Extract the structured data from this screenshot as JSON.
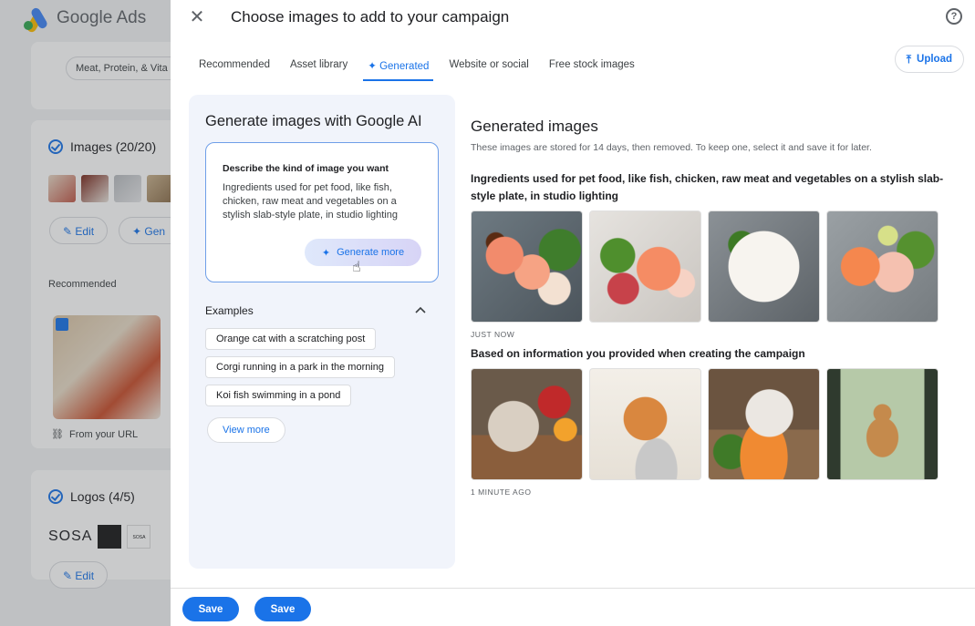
{
  "app": {
    "name": "Google Ads"
  },
  "background": {
    "category_chip": "Meat, Protein, & Vita",
    "images_section": "Images (20/20)",
    "edit_label": "Edit",
    "generate_label": "Gen",
    "recommended_label": "Recommended",
    "from_url": "From your URL",
    "logos_section": "Logos (4/5)",
    "logo_text": "SOSA",
    "logo_small": "SOSA",
    "edit_label_2": "Edit"
  },
  "dialog": {
    "title": "Choose images to add to your campaign",
    "tabs": [
      {
        "label": "Recommended"
      },
      {
        "label": "Asset library"
      },
      {
        "label": "✦ Generated",
        "active": true
      },
      {
        "label": "Website or social"
      },
      {
        "label": "Free stock images"
      }
    ],
    "upload_label": "Upload"
  },
  "generator": {
    "title": "Generate images with Google AI",
    "prompt_label": "Describe the kind of image you want",
    "prompt_text": "Ingredients used for pet food, like fish, chicken, raw meat and vegetables on a stylish slab-style plate, in studio lighting",
    "generate_more": "Generate more",
    "examples_label": "Examples",
    "examples": [
      "Orange cat with a scratching post",
      "Corgi running in a park in the morning",
      "Koi fish swimming in a pond"
    ],
    "view_more": "View more"
  },
  "generated": {
    "title": "Generated images",
    "subtitle": "These images are stored for 14 days, then removed. To keep one, select it and save it for later.",
    "groups": [
      {
        "title": "Ingredients used for pet food, like fish, chicken, raw meat and vegetables on a stylish slab-style plate, in studio lighting",
        "timestamp": "JUST NOW"
      },
      {
        "title": "Based on information you provided when creating the campaign",
        "timestamp": "1 MINUTE AGO"
      }
    ]
  },
  "footer": {
    "save_1": "Save",
    "save_2": "Save"
  },
  "colors": {
    "accent": "#1a73e8",
    "panel": "#f1f4fb"
  }
}
